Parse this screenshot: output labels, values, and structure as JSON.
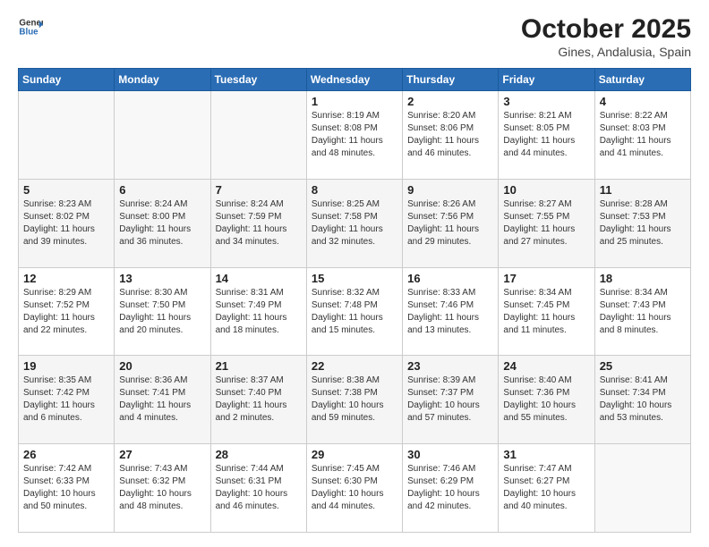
{
  "logo": {
    "line1": "General",
    "line2": "Blue"
  },
  "title": "October 2025",
  "subtitle": "Gines, Andalusia, Spain",
  "days_of_week": [
    "Sunday",
    "Monday",
    "Tuesday",
    "Wednesday",
    "Thursday",
    "Friday",
    "Saturday"
  ],
  "weeks": [
    [
      {
        "day": "",
        "info": ""
      },
      {
        "day": "",
        "info": ""
      },
      {
        "day": "",
        "info": ""
      },
      {
        "day": "1",
        "info": "Sunrise: 8:19 AM\nSunset: 8:08 PM\nDaylight: 11 hours and 48 minutes."
      },
      {
        "day": "2",
        "info": "Sunrise: 8:20 AM\nSunset: 8:06 PM\nDaylight: 11 hours and 46 minutes."
      },
      {
        "day": "3",
        "info": "Sunrise: 8:21 AM\nSunset: 8:05 PM\nDaylight: 11 hours and 44 minutes."
      },
      {
        "day": "4",
        "info": "Sunrise: 8:22 AM\nSunset: 8:03 PM\nDaylight: 11 hours and 41 minutes."
      }
    ],
    [
      {
        "day": "5",
        "info": "Sunrise: 8:23 AM\nSunset: 8:02 PM\nDaylight: 11 hours and 39 minutes."
      },
      {
        "day": "6",
        "info": "Sunrise: 8:24 AM\nSunset: 8:00 PM\nDaylight: 11 hours and 36 minutes."
      },
      {
        "day": "7",
        "info": "Sunrise: 8:24 AM\nSunset: 7:59 PM\nDaylight: 11 hours and 34 minutes."
      },
      {
        "day": "8",
        "info": "Sunrise: 8:25 AM\nSunset: 7:58 PM\nDaylight: 11 hours and 32 minutes."
      },
      {
        "day": "9",
        "info": "Sunrise: 8:26 AM\nSunset: 7:56 PM\nDaylight: 11 hours and 29 minutes."
      },
      {
        "day": "10",
        "info": "Sunrise: 8:27 AM\nSunset: 7:55 PM\nDaylight: 11 hours and 27 minutes."
      },
      {
        "day": "11",
        "info": "Sunrise: 8:28 AM\nSunset: 7:53 PM\nDaylight: 11 hours and 25 minutes."
      }
    ],
    [
      {
        "day": "12",
        "info": "Sunrise: 8:29 AM\nSunset: 7:52 PM\nDaylight: 11 hours and 22 minutes."
      },
      {
        "day": "13",
        "info": "Sunrise: 8:30 AM\nSunset: 7:50 PM\nDaylight: 11 hours and 20 minutes."
      },
      {
        "day": "14",
        "info": "Sunrise: 8:31 AM\nSunset: 7:49 PM\nDaylight: 11 hours and 18 minutes."
      },
      {
        "day": "15",
        "info": "Sunrise: 8:32 AM\nSunset: 7:48 PM\nDaylight: 11 hours and 15 minutes."
      },
      {
        "day": "16",
        "info": "Sunrise: 8:33 AM\nSunset: 7:46 PM\nDaylight: 11 hours and 13 minutes."
      },
      {
        "day": "17",
        "info": "Sunrise: 8:34 AM\nSunset: 7:45 PM\nDaylight: 11 hours and 11 minutes."
      },
      {
        "day": "18",
        "info": "Sunrise: 8:34 AM\nSunset: 7:43 PM\nDaylight: 11 hours and 8 minutes."
      }
    ],
    [
      {
        "day": "19",
        "info": "Sunrise: 8:35 AM\nSunset: 7:42 PM\nDaylight: 11 hours and 6 minutes."
      },
      {
        "day": "20",
        "info": "Sunrise: 8:36 AM\nSunset: 7:41 PM\nDaylight: 11 hours and 4 minutes."
      },
      {
        "day": "21",
        "info": "Sunrise: 8:37 AM\nSunset: 7:40 PM\nDaylight: 11 hours and 2 minutes."
      },
      {
        "day": "22",
        "info": "Sunrise: 8:38 AM\nSunset: 7:38 PM\nDaylight: 10 hours and 59 minutes."
      },
      {
        "day": "23",
        "info": "Sunrise: 8:39 AM\nSunset: 7:37 PM\nDaylight: 10 hours and 57 minutes."
      },
      {
        "day": "24",
        "info": "Sunrise: 8:40 AM\nSunset: 7:36 PM\nDaylight: 10 hours and 55 minutes."
      },
      {
        "day": "25",
        "info": "Sunrise: 8:41 AM\nSunset: 7:34 PM\nDaylight: 10 hours and 53 minutes."
      }
    ],
    [
      {
        "day": "26",
        "info": "Sunrise: 7:42 AM\nSunset: 6:33 PM\nDaylight: 10 hours and 50 minutes."
      },
      {
        "day": "27",
        "info": "Sunrise: 7:43 AM\nSunset: 6:32 PM\nDaylight: 10 hours and 48 minutes."
      },
      {
        "day": "28",
        "info": "Sunrise: 7:44 AM\nSunset: 6:31 PM\nDaylight: 10 hours and 46 minutes."
      },
      {
        "day": "29",
        "info": "Sunrise: 7:45 AM\nSunset: 6:30 PM\nDaylight: 10 hours and 44 minutes."
      },
      {
        "day": "30",
        "info": "Sunrise: 7:46 AM\nSunset: 6:29 PM\nDaylight: 10 hours and 42 minutes."
      },
      {
        "day": "31",
        "info": "Sunrise: 7:47 AM\nSunset: 6:27 PM\nDaylight: 10 hours and 40 minutes."
      },
      {
        "day": "",
        "info": ""
      }
    ]
  ]
}
